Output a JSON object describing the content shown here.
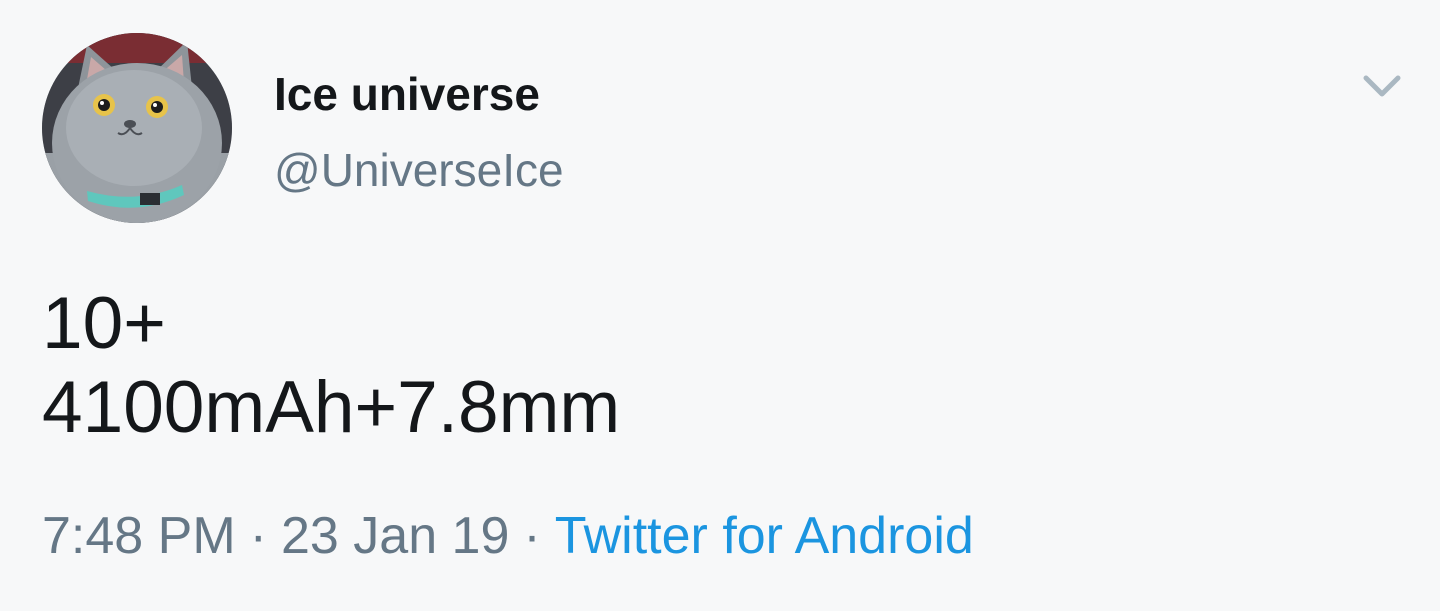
{
  "tweet": {
    "author": {
      "name": "Ice universe",
      "handle": "@UniverseIce",
      "avatar_icon": "cat-avatar"
    },
    "text_lines": [
      "10+",
      "4100mAh+7.8mm"
    ],
    "time": "7:48 PM",
    "separator": "·",
    "date": "23 Jan 19",
    "source": "Twitter for Android",
    "menu_icon": "chevron-down-icon"
  },
  "colors": {
    "background": "#f7f8f9",
    "text": "#14171a",
    "secondary_text": "#657786",
    "link": "#1b95e0"
  }
}
